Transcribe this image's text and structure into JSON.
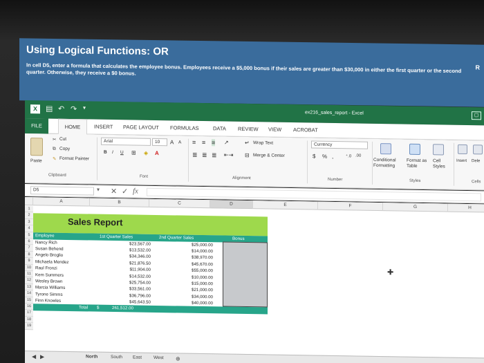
{
  "banner": {
    "title": "Using Logical Functions: OR",
    "instruction": "In cell D5, enter a formula that calculates the employee bonus. Employees receive a $5,000 bonus if their sales are greater than $30,000 in either the first quarter or the second quarter. Otherwise, they receive a $0 bonus.",
    "side_text": "R"
  },
  "window": {
    "title": "ex216_sales_report - Excel",
    "app_icon": "X"
  },
  "tabs": [
    "FILE",
    "HOME",
    "INSERT",
    "PAGE LAYOUT",
    "FORMULAS",
    "DATA",
    "REVIEW",
    "VIEW",
    "ACROBAT"
  ],
  "ribbon": {
    "clipboard": {
      "cut": "Cut",
      "copy": "Copy",
      "format_painter": "Format Painter",
      "paste": "Paste",
      "group": "Clipboard"
    },
    "font": {
      "name": "Arial",
      "size": "10",
      "bold": "B",
      "italic": "I",
      "underline": "U",
      "grow": "A",
      "shrink": "A",
      "color": "A",
      "group": "Font"
    },
    "alignment": {
      "wrap": "Wrap Text",
      "merge": "Merge & Center",
      "group": "Alignment"
    },
    "number": {
      "format": "Currency",
      "dollar": "$",
      "percent": "%",
      "comma": ",",
      "group": "Number"
    },
    "styles": {
      "conditional": "Conditional Formatting",
      "format_table": "Format as Table",
      "cell_styles": "Cell Styles",
      "group": "Styles"
    },
    "cells": {
      "insert": "Insert",
      "delete": "Dele",
      "group": "Cells"
    }
  },
  "formula_bar": {
    "name_box": "D5",
    "fx": "fx",
    "cancel": "✕",
    "enter": "✓"
  },
  "columns": [
    "A",
    "B",
    "C",
    "D",
    "E",
    "F",
    "G",
    "H"
  ],
  "rows": [
    "1",
    "2",
    "3",
    "4",
    "5",
    "6",
    "7",
    "8",
    "9",
    "10",
    "11",
    "12",
    "13",
    "14",
    "15",
    "16",
    "17",
    "18",
    "19"
  ],
  "sheet": {
    "title": "Sales Report",
    "headers": {
      "employee": "Employee",
      "q1": "1st Quarter Sales",
      "q2": "2nd Quarter Sales",
      "bonus": "Bonus"
    },
    "employees": [
      {
        "name": "Nancy Rich",
        "q1": "$23,567.00",
        "q2": "$25,000.00"
      },
      {
        "name": "Susan Behend",
        "q1": "$13,532.00",
        "q2": "$14,000.00"
      },
      {
        "name": "Angelo Broglio",
        "q1": "$34,346.00",
        "q2": "$38,970.00"
      },
      {
        "name": "Michaela Mendez",
        "q1": "$21,876.50",
        "q2": "$45,670.00"
      },
      {
        "name": "Raul Fronzi",
        "q1": "$11,904.00",
        "q2": "$55,000.00"
      },
      {
        "name": "Kem Summers",
        "q1": "$14,532.00",
        "q2": "$10,000.00"
      },
      {
        "name": "Wesley Brown",
        "q1": "$25,754.00",
        "q2": "$15,000.00"
      },
      {
        "name": "Marcia Williams",
        "q1": "$33,561.00",
        "q2": "$21,000.00"
      },
      {
        "name": "Tyrone Simms",
        "q1": "$36,796.00",
        "q2": "$34,000.00"
      },
      {
        "name": "Finn Knowles",
        "q1": "$45,643.50",
        "q2": "$40,000.00"
      }
    ],
    "total_label": "Total",
    "total_currency": "$",
    "total_value": "261,512.00"
  },
  "sheet_tabs": [
    "North",
    "South",
    "East",
    "West"
  ],
  "colors": {
    "excel_green": "#217346",
    "banner_blue": "#3a6c9c",
    "title_band": "#9ed94c",
    "header_band": "#27a58a"
  }
}
